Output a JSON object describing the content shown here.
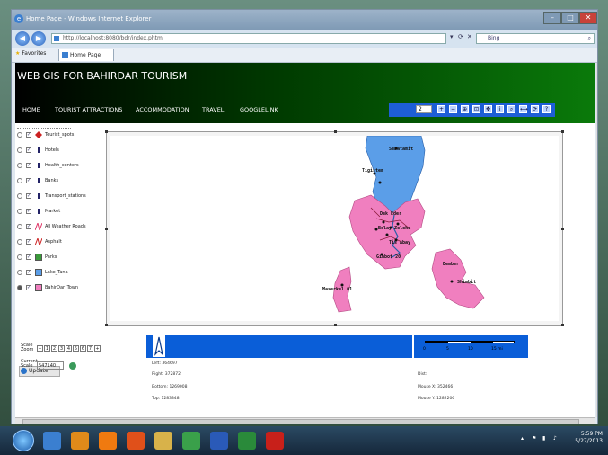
{
  "browser": {
    "title": "Home Page - Windows Internet Explorer",
    "address": "http://localhost:8080/bdr/index.phtml",
    "search_placeholder": "Bing",
    "favorites_label": "Favorites",
    "tab_label": "Home Page"
  },
  "site": {
    "title": "WEB GIS FOR BAHIRDAR TOURISM",
    "menu": [
      "HOME",
      "TOURIST ATTRACTIONS",
      "ACCOMMODATION",
      "TRAVEL",
      "GOOGLELINK"
    ],
    "zoom_value": "2",
    "tool_icons": [
      "zoom-in-icon",
      "zoom-out-icon",
      "zoom-full-icon",
      "zoom-select-icon",
      "pan-icon",
      "info-icon",
      "search-icon",
      "measure-icon",
      "refresh-icon",
      "help-icon"
    ]
  },
  "layers": [
    {
      "name": "Tourist_spots",
      "color": "#cc2222",
      "icon": "diamond"
    },
    {
      "name": "Hotels",
      "color": "#222266",
      "icon": "pin"
    },
    {
      "name": "Health_centers",
      "color": "#222266",
      "icon": "pin"
    },
    {
      "name": "Banks",
      "color": "#222266",
      "icon": "pin"
    },
    {
      "name": "Transport_stations",
      "color": "#222266",
      "icon": "pin"
    },
    {
      "name": "Market",
      "color": "#222266",
      "icon": "pin"
    },
    {
      "name": "All Weather Roads",
      "color": "#e03a6a",
      "icon": "line"
    },
    {
      "name": "Asphalt",
      "color": "#cc2222",
      "icon": "line"
    },
    {
      "name": "Parks",
      "color": "#3a9a3a",
      "icon": "box"
    },
    {
      "name": "Lake_Tana",
      "color": "#5b9ee8",
      "icon": "box"
    },
    {
      "name": "BahirDar_Town",
      "color": "#f07fbf",
      "icon": "box"
    }
  ],
  "update_label": "Update",
  "map_labels": {
    "top": "Sebatamit",
    "l1": "Tigistem",
    "l2": "Dek Eder",
    "l3": "Belay Zeleke",
    "l4": "Tis Abay",
    "l5": "Ginbot 20",
    "l6": "Dember",
    "l7": "Shimbit",
    "l8": "Maserkel 01"
  },
  "controls": {
    "scale_zoom_label": "Scale Zoom",
    "zoom_levels": [
      "1",
      "2",
      "3",
      "4",
      "5",
      "6",
      "7"
    ],
    "current_scale_label": "Current Scale",
    "current_scale_value": "547140"
  },
  "scalebar": {
    "ticks": [
      "0",
      "5",
      "10",
      "15 mi"
    ]
  },
  "coords": {
    "left": "Left: 364697",
    "right": "Right: 372872",
    "bottom": "Bottom: 1269008",
    "top": "Top: 1283348",
    "dist": "Dist:",
    "mouse_x": "Mouse X: 352466",
    "mouse_y": "Mouse Y: 1282206"
  },
  "taskbar": {
    "time": "5:59 PM",
    "date": "5/27/2013",
    "apps": [
      "ie-icon",
      "media-player-icon",
      "vlc-icon",
      "firefox-icon",
      "folder-icon",
      "utorrent-icon",
      "word-icon",
      "excel-icon",
      "acrobat-icon"
    ]
  }
}
